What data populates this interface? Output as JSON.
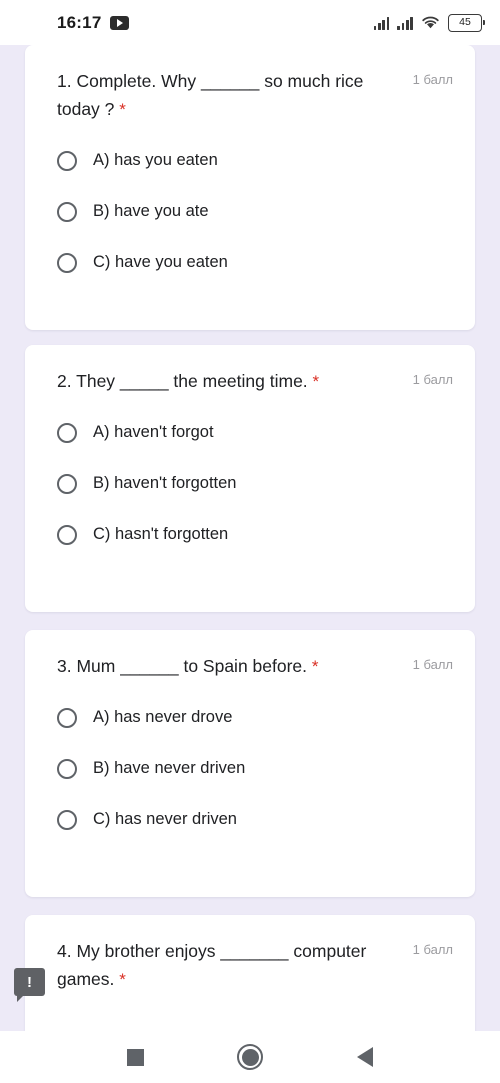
{
  "statusbar": {
    "time": "16:17",
    "app_icon": "youtube-icon",
    "signal_1_icon": "signal-bars-icon",
    "signal_2_icon": "signal-bars-icon",
    "wifi_icon": "wifi-icon",
    "battery_level": "45"
  },
  "form": {
    "points_label": "1 балл",
    "required_marker": "*",
    "comment_badge": "!",
    "questions": [
      {
        "text": "1. Complete. Why ______ so much rice today ?",
        "points": "1 балл",
        "options": [
          "A) has you eaten",
          "B) have you ate",
          "C) have you eaten"
        ]
      },
      {
        "text": "2. They _____ the meeting time.",
        "points": "1 балл",
        "options": [
          "A) haven't forgot",
          "B) haven't forgotten",
          "C) hasn't forgotten"
        ]
      },
      {
        "text": "3. Mum ______ to Spain before.",
        "points": "1 балл",
        "options": [
          "A) has never drove",
          "B) have never driven",
          "C) has never driven"
        ]
      },
      {
        "text": "4. My brother enjoys _______ computer games.",
        "points": "1 балл",
        "options": []
      }
    ]
  },
  "navbar": {
    "recents_icon": "square-recents-icon",
    "home_icon": "circle-home-icon",
    "back_icon": "triangle-back-icon"
  },
  "colors": {
    "background": "#edeaf7",
    "card": "#ffffff",
    "text": "#202124",
    "muted": "#9b9b9f",
    "required": "#d93025"
  }
}
